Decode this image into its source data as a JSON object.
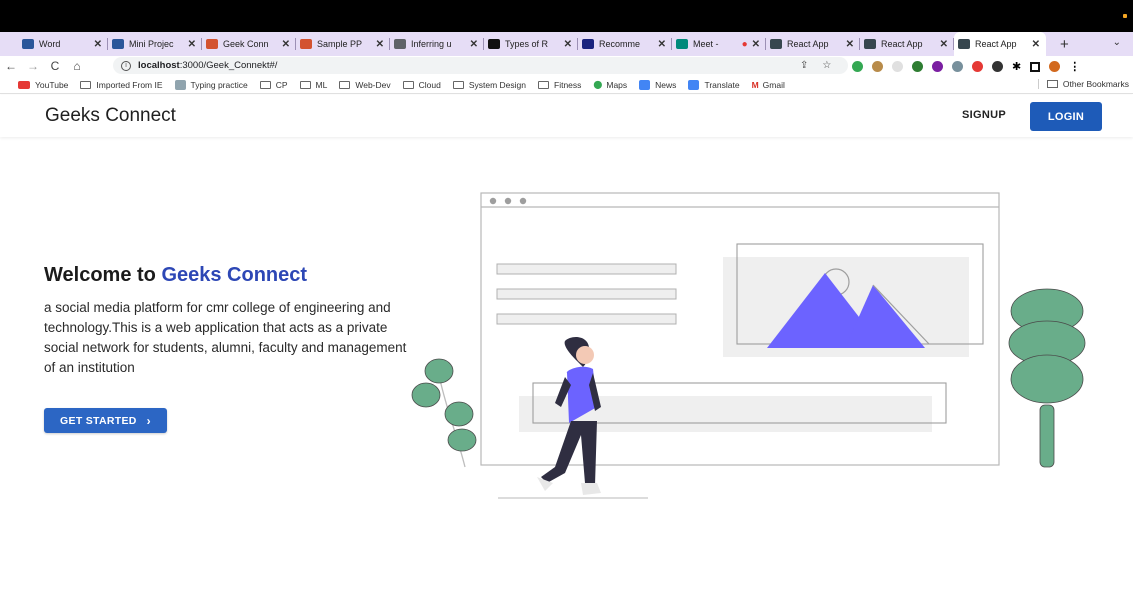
{
  "browser": {
    "tabs": [
      {
        "label": "Word",
        "color": "#2b579a"
      },
      {
        "label": "Mini Projec",
        "color": "#2b579a"
      },
      {
        "label": "Geek Conn",
        "color": "#d35230"
      },
      {
        "label": "Sample PP",
        "color": "#d35230"
      },
      {
        "label": "Inferring u",
        "color": "#5f6368"
      },
      {
        "label": "Types of R",
        "color": "#111111"
      },
      {
        "label": "Recomme",
        "color": "#1a237e"
      },
      {
        "label": "Meet -",
        "color": "#00897b"
      },
      {
        "label": "React App",
        "color": "#37474f"
      },
      {
        "label": "React App",
        "color": "#37474f"
      },
      {
        "label": "React App",
        "color": "#37474f"
      }
    ],
    "new_tab_label": "+",
    "tab_close": "✕",
    "url_host": "localhost",
    "url_rest": ":3000/Geek_Connekt#/",
    "bookmarks": [
      {
        "label": "YouTube",
        "kind": "youtube"
      },
      {
        "label": "Imported From IE",
        "kind": "folder"
      },
      {
        "label": "Typing practice",
        "kind": "page"
      },
      {
        "label": "CP",
        "kind": "folder"
      },
      {
        "label": "ML",
        "kind": "folder"
      },
      {
        "label": "Web-Dev",
        "kind": "folder"
      },
      {
        "label": "Cloud",
        "kind": "folder"
      },
      {
        "label": "System Design",
        "kind": "folder"
      },
      {
        "label": "Fitness",
        "kind": "folder"
      },
      {
        "label": "Maps",
        "kind": "maps"
      },
      {
        "label": "News",
        "kind": "news"
      },
      {
        "label": "Translate",
        "kind": "translate"
      },
      {
        "label": "Gmail",
        "kind": "gmail"
      }
    ],
    "other_bookmarks": "Other Bookmarks"
  },
  "header": {
    "brand": "Geeks Connect",
    "signup": "SIGNUP",
    "login": "LOGIN"
  },
  "hero": {
    "welcome": "Welcome to ",
    "welcome_accent": "Geeks Connect",
    "description": "a social media platform for cmr college of engineering and technology.This is a web application that acts as a private social network for students, alumni, faculty and management of an institution",
    "cta": "GET STARTED",
    "cta_icon": "›"
  },
  "colors": {
    "primary": "#1e5bb8",
    "accent_text": "#2d47b5",
    "illustration_purple": "#6c63ff",
    "plant_green": "#69ad8a"
  }
}
